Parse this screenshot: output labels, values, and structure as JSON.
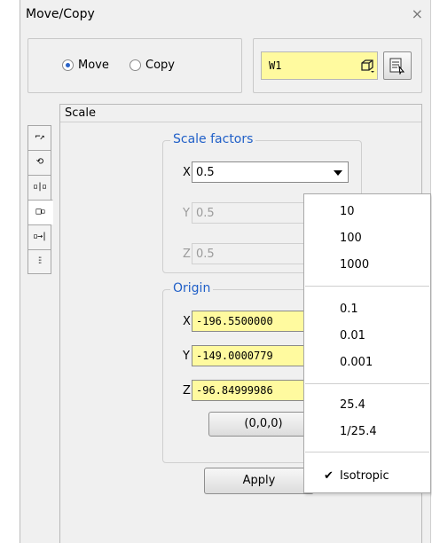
{
  "window": {
    "title": "Move/Copy",
    "close_glyph": "×"
  },
  "mode": {
    "move_label": "Move",
    "copy_label": "Copy",
    "selected": "Move"
  },
  "workplane": {
    "value": "W1",
    "icon": "workplane-cube-icon",
    "button_icon": "workplane-select-icon"
  },
  "tabs": [
    {
      "name": "translate-tab",
      "icon": "translate-icon",
      "glyph": "⌐↗"
    },
    {
      "name": "rotate-tab",
      "icon": "rotate-icon",
      "glyph": "⟲"
    },
    {
      "name": "mirror-tab",
      "icon": "mirror-icon",
      "glyph": "▫|▫"
    },
    {
      "name": "scale-tab",
      "icon": "scale-icon",
      "glyph": "□▫"
    },
    {
      "name": "align-tab",
      "icon": "align-icon",
      "glyph": "▫→|"
    },
    {
      "name": "array-tab",
      "icon": "array-icon",
      "glyph": "⫶⫶"
    }
  ],
  "scale": {
    "title": "Scale",
    "factors_title": "Scale factors",
    "x_label": "X",
    "x_value": "0.5",
    "y_label": "Y",
    "y_value": "0.5",
    "z_label": "Z",
    "z_value": "0.5",
    "origin_title": "Origin",
    "ox_label": "X",
    "ox_value": "-196.5500000",
    "oy_label": "Y",
    "oy_value": "-149.0000779",
    "oz_label": "Z",
    "oz_value": "-96.84999986",
    "origin_reset_label": "(0,0,0)",
    "apply_label": "Apply"
  },
  "dropdown": {
    "groups": [
      [
        "10",
        "100",
        "1000"
      ],
      [
        "0.1",
        "0.01",
        "0.001"
      ],
      [
        "25.4",
        "1/25.4"
      ]
    ],
    "check_glyph": "✔",
    "isotropic_label": "Isotropic",
    "isotropic_checked": true
  },
  "colors": {
    "accent": "#2160c8",
    "input_highlight": "#fffa9f"
  }
}
